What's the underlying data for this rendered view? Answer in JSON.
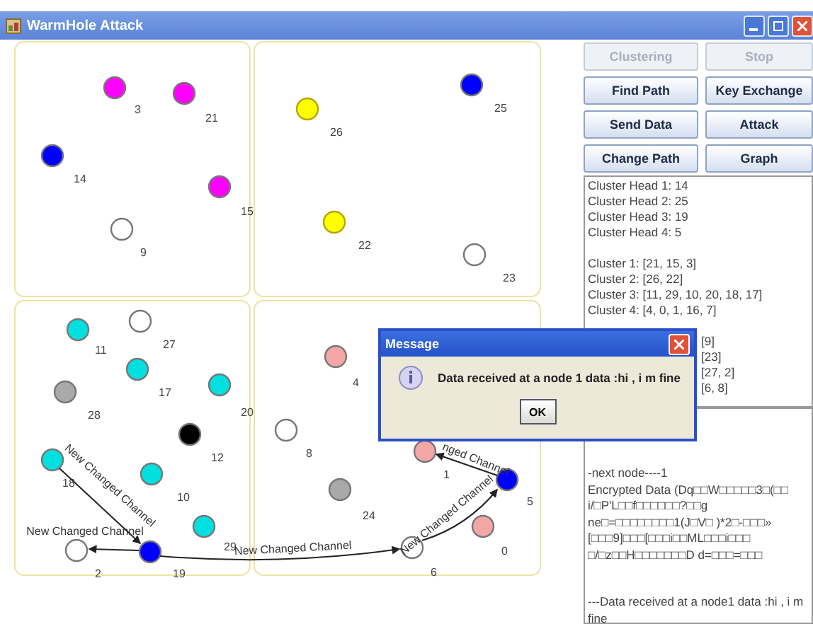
{
  "window": {
    "title": "WarmHole Attack"
  },
  "nodes": [
    {
      "label": "3",
      "color": "#ff00ff"
    },
    {
      "label": "21",
      "color": "#ff00ff"
    },
    {
      "label": "14",
      "color": "#0000ff"
    },
    {
      "label": "15",
      "color": "#ff00ff"
    },
    {
      "label": "9",
      "color": "#ffffff"
    },
    {
      "label": "26",
      "color": "#ffff00"
    },
    {
      "label": "25",
      "color": "#0000ff"
    },
    {
      "label": "22",
      "color": "#ffff00"
    },
    {
      "label": "23",
      "color": "#ffffff"
    },
    {
      "label": "11",
      "color": "#00e0e0"
    },
    {
      "label": "27",
      "color": "#ffffff"
    },
    {
      "label": "17",
      "color": "#00e0e0"
    },
    {
      "label": "28",
      "color": "#a9a9a9"
    },
    {
      "label": "20",
      "color": "#00e0e0"
    },
    {
      "label": "12",
      "color": "#000000"
    },
    {
      "label": "18",
      "color": "#00e0e0"
    },
    {
      "label": "10",
      "color": "#00e0e0"
    },
    {
      "label": "29",
      "color": "#00e0e0"
    },
    {
      "label": "2",
      "color": "#ffffff"
    },
    {
      "label": "19",
      "color": "#0000ff"
    },
    {
      "label": "4",
      "color": "#f4a6a6"
    },
    {
      "label": "8",
      "color": "#ffffff"
    },
    {
      "label": "24",
      "color": "#a9a9a9"
    },
    {
      "label": "1",
      "color": "#f4a6a6"
    },
    {
      "label": "5",
      "color": "#0000ff"
    },
    {
      "label": "0",
      "color": "#f4a6a6"
    },
    {
      "label": "6",
      "color": "#ffffff"
    }
  ],
  "edges": [
    {
      "label": "New Changed Channel"
    },
    {
      "label": "New Changed Channel"
    },
    {
      "label": "New Changed Channel"
    },
    {
      "label": "New Changed Channel"
    },
    {
      "label": "nged Channel"
    }
  ],
  "buttons": [
    {
      "label": "Clustering",
      "disabled": true
    },
    {
      "label": "Stop",
      "disabled": true
    },
    {
      "label": "Find Path",
      "disabled": false
    },
    {
      "label": "Key Exchange",
      "disabled": false
    },
    {
      "label": "Send Data",
      "disabled": false
    },
    {
      "label": "Attack",
      "disabled": false
    },
    {
      "label": "Change Path",
      "disabled": false
    },
    {
      "label": "Graph",
      "disabled": false
    }
  ],
  "cluster_log": [
    {
      "kind": "line",
      "text": "Cluster Head 1: 14"
    },
    {
      "kind": "line",
      "text": "Cluster Head 2: 25"
    },
    {
      "kind": "line",
      "text": "Cluster Head 3: 19"
    },
    {
      "kind": "line",
      "text": "Cluster Head 4: 5"
    },
    {
      "kind": "blank"
    },
    {
      "kind": "line",
      "text": "Cluster 1: [21, 15, 3]"
    },
    {
      "kind": "line",
      "text": "Cluster 2: [26, 22]"
    },
    {
      "kind": "line",
      "text": "Cluster 3: [11, 29, 10, 20, 18, 17]"
    },
    {
      "kind": "line",
      "text": "Cluster 4: [4, 0, 1, 16, 7]"
    },
    {
      "kind": "blank"
    },
    {
      "kind": "covered",
      "text": "[9]"
    },
    {
      "kind": "covered",
      "text": "[23]"
    },
    {
      "kind": "covered",
      "text": "[27, 2]"
    },
    {
      "kind": "covered",
      "text": "[6, 8]"
    }
  ],
  "data_log": [
    {
      "kind": "line",
      "text": "-next node----1"
    },
    {
      "kind": "line",
      "text": "Encrypted Data (Dq□□W□□□□□3□(□□"
    },
    {
      "kind": "line",
      "text": "i/□P'L□□f□□□□□□?□□g"
    },
    {
      "kind": "line",
      "text": "ne□=□□□□□□□□1(J□V□ )*2□-□□□»"
    },
    {
      "kind": "line",
      "text": "[□□□9]□□□[□□□i□□ML□□□i□□□"
    },
    {
      "kind": "line",
      "text": "□/□z□□H□□□□□□□D d=□□□=□□□"
    },
    {
      "kind": "blank"
    },
    {
      "kind": "blank"
    },
    {
      "kind": "line",
      "text": "---Data received at a node1 data :hi , i m fine"
    }
  ],
  "dialog": {
    "title": "Message",
    "message": "Data received at a node 1 data :hi , i m fine",
    "button": "OK"
  }
}
